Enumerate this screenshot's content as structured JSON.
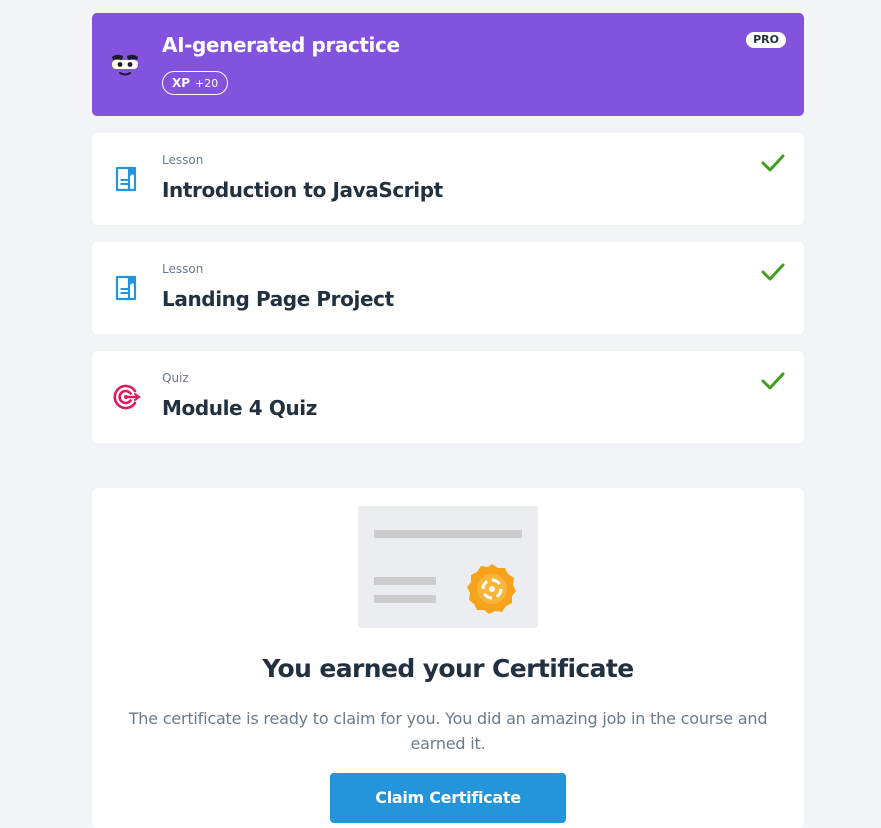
{
  "practice": {
    "title": "AI-generated practice",
    "xp_label": "XP",
    "xp_value": "+20",
    "badge": "PRO",
    "icon": "mascot-face-icon",
    "color": "#8353dd"
  },
  "items": [
    {
      "kind": "Lesson",
      "name": "Introduction to JavaScript",
      "icon": "lesson-document-icon",
      "completed": true
    },
    {
      "kind": "Lesson",
      "name": "Landing Page Project",
      "icon": "lesson-document-icon",
      "completed": true
    },
    {
      "kind": "Quiz",
      "name": "Module 4 Quiz",
      "icon": "quiz-target-icon",
      "completed": true
    }
  ],
  "certificate": {
    "title": "You earned your Certificate",
    "description": "The certificate is ready to claim for you. You did an amazing job in the course and earned it.",
    "button_label": "Claim Certificate",
    "icon": "certificate-icon"
  },
  "colors": {
    "accent_blue": "#2495db",
    "check_green": "#3ea01e",
    "quiz_pink": "#e0195f",
    "seal_orange": "#f7a21b"
  }
}
